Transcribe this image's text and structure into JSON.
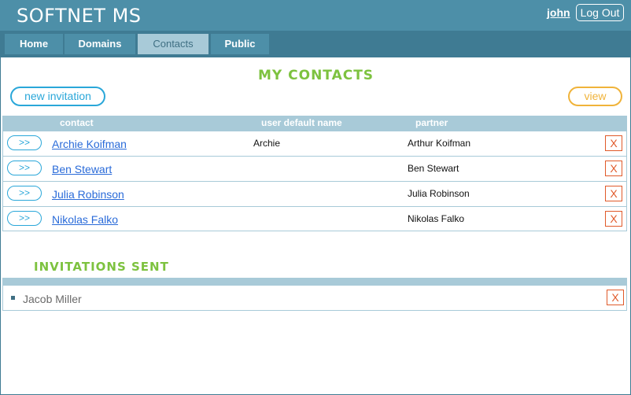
{
  "header": {
    "app_title": "SOFTNET MS",
    "user": "john",
    "logout_label": "Log Out"
  },
  "nav": {
    "tabs": [
      {
        "label": "Home",
        "active": false
      },
      {
        "label": "Domains",
        "active": false
      },
      {
        "label": "Contacts",
        "active": true
      },
      {
        "label": "Public",
        "active": false
      }
    ]
  },
  "contacts": {
    "title": "MY CONTACTS",
    "new_invitation_label": "new invitation",
    "view_label": "view",
    "columns": {
      "contact": "contact",
      "user_default_name": "user default name",
      "partner": "partner"
    },
    "rows": [
      {
        "open": ">>",
        "contact": "Archie Koifman",
        "default_name": "Archie",
        "partner": "Arthur Koifman",
        "delete": "X"
      },
      {
        "open": ">>",
        "contact": "Ben Stewart",
        "default_name": "",
        "partner": "Ben Stewart",
        "delete": "X"
      },
      {
        "open": ">>",
        "contact": "Julia Robinson",
        "default_name": "",
        "partner": "Julia Robinson",
        "delete": "X"
      },
      {
        "open": ">>",
        "contact": "Nikolas Falko",
        "default_name": "",
        "partner": "Nikolas Falko",
        "delete": "X"
      }
    ]
  },
  "invitations": {
    "title": "INVITATIONS SENT",
    "items": [
      {
        "name": "Jacob Miller",
        "delete": "X"
      }
    ]
  },
  "colors": {
    "header_bg": "#4d8fa8",
    "nav_bg": "#3f7b93",
    "active_tab": "#a8cad8",
    "accent_green": "#7dc23f",
    "accent_blue": "#2aa7d9",
    "accent_orange": "#f0b33a",
    "delete_red": "#e05a2a"
  }
}
